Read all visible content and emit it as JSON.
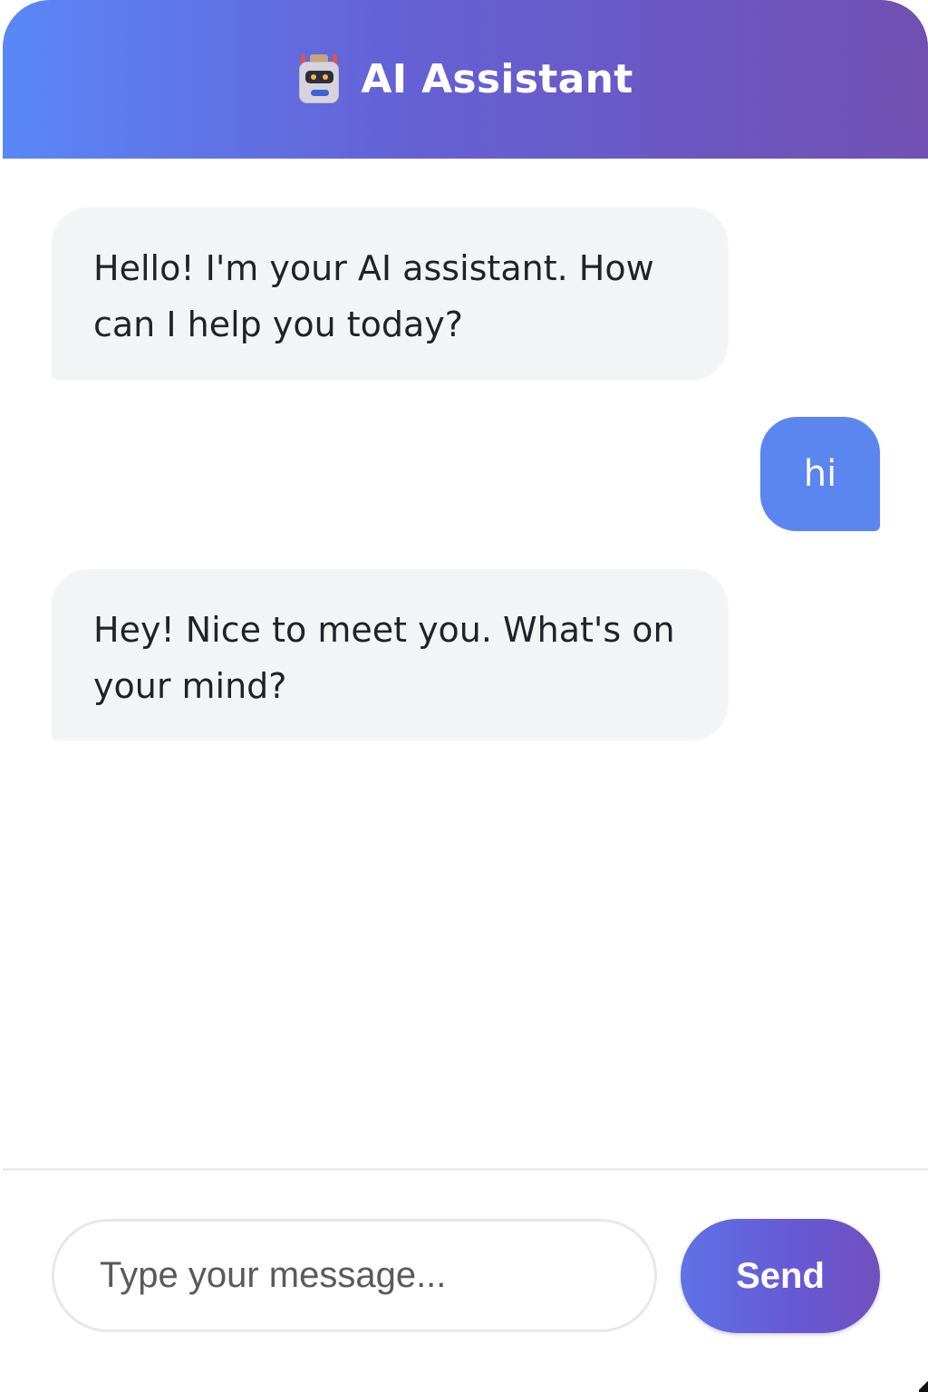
{
  "header": {
    "icon": "robot-icon",
    "title": "AI Assistant",
    "gradient_start": "#5a87f7",
    "gradient_end": "#7150b2"
  },
  "messages": [
    {
      "role": "assistant",
      "text": "Hello! I'm your AI assistant. How can I help you today?"
    },
    {
      "role": "user",
      "text": "hi"
    },
    {
      "role": "assistant",
      "text": "Hey! Nice to meet you. What's on your mind?"
    }
  ],
  "composer": {
    "placeholder": "Type your message...",
    "value": "",
    "send_label": "Send"
  },
  "colors": {
    "user_bubble": "#5b86f0",
    "assistant_bubble": "#f3f4f6",
    "send_button": "#6659d6"
  }
}
